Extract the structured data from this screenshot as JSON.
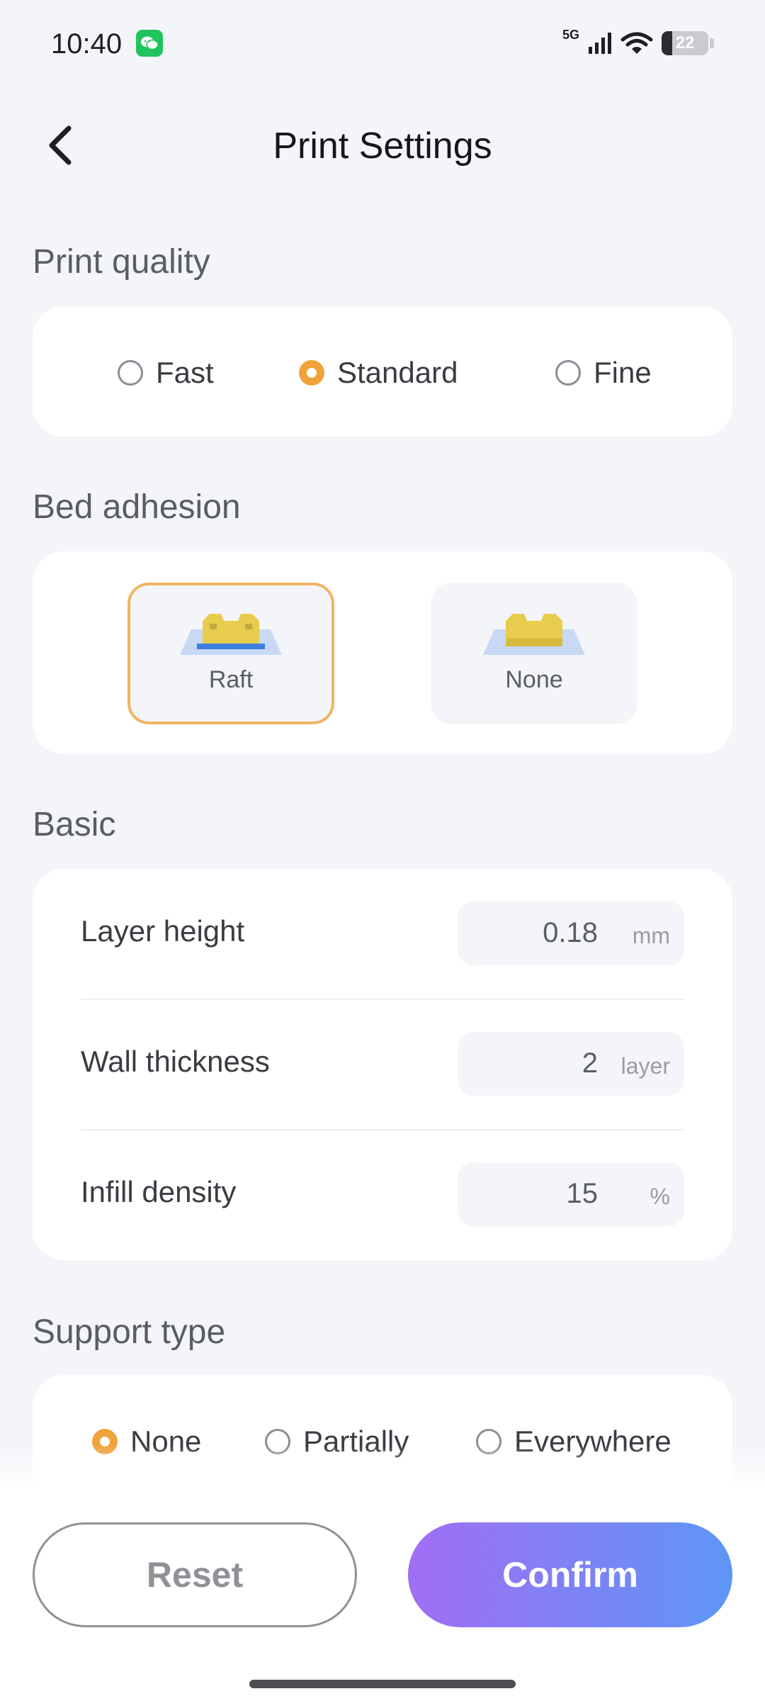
{
  "status_bar": {
    "time": "10:40",
    "network": "5G",
    "battery": "22",
    "battery_fraction": 0.22,
    "icons": [
      "wechat-icon",
      "signal-icon",
      "wifi-icon",
      "battery-icon"
    ]
  },
  "header": {
    "title": "Print Settings",
    "back_icon": "chevron-left-icon"
  },
  "print_quality": {
    "title": "Print quality",
    "options": [
      {
        "label": "Fast",
        "checked": false
      },
      {
        "label": "Standard",
        "checked": true
      },
      {
        "label": "Fine",
        "checked": false
      }
    ]
  },
  "bed_adhesion": {
    "title": "Bed adhesion",
    "options": [
      {
        "label": "Raft",
        "selected": true
      },
      {
        "label": "None",
        "selected": false
      }
    ]
  },
  "basic": {
    "title": "Basic",
    "rows": [
      {
        "label": "Layer height",
        "value": "0.18",
        "unit": "mm"
      },
      {
        "label": "Wall thickness",
        "value": "2",
        "unit": "layer"
      },
      {
        "label": "Infill density",
        "value": "15",
        "unit": "%"
      }
    ]
  },
  "support_type": {
    "title": "Support type",
    "options": [
      {
        "label": "None",
        "checked": true
      },
      {
        "label": "Partially",
        "checked": false
      },
      {
        "label": "Everywhere",
        "checked": false
      }
    ]
  },
  "footer": {
    "reset_label": "Reset",
    "confirm_label": "Confirm"
  },
  "colors": {
    "accent_orange": "#f0a23b",
    "confirm_gradient_start": "#a06ef4",
    "confirm_gradient_end": "#5e96f6",
    "background": "#f4f5f9"
  }
}
